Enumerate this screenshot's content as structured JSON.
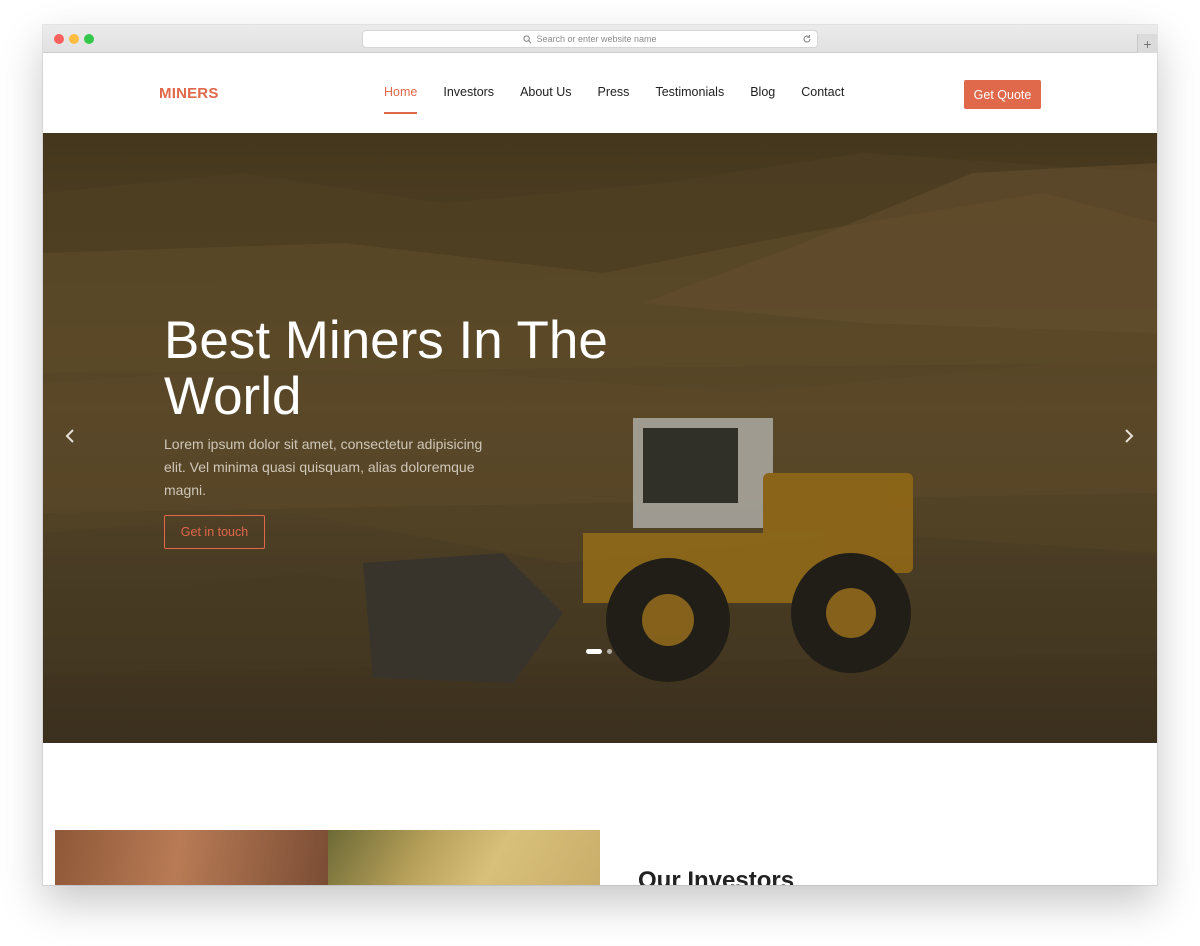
{
  "browser": {
    "address_placeholder": "Search or enter website name",
    "new_tab_label": "+"
  },
  "site": {
    "brand": "MINERS",
    "accent_color": "#e0684b"
  },
  "nav": {
    "items": [
      {
        "label": "Home",
        "active": true
      },
      {
        "label": "Investors"
      },
      {
        "label": "About Us"
      },
      {
        "label": "Press"
      },
      {
        "label": "Testimonials"
      },
      {
        "label": "Blog"
      },
      {
        "label": "Contact"
      }
    ],
    "cta": "Get Quote"
  },
  "hero": {
    "title": "Best Miners In The World",
    "text": "Lorem ipsum dolor sit amet, consectetur adipisicing elit. Vel minima quasi quisquam, alias doloremque magni.",
    "button": "Get in touch",
    "slides_total": 2,
    "slide_active": 1
  },
  "investors": {
    "title": "Our Investors"
  }
}
